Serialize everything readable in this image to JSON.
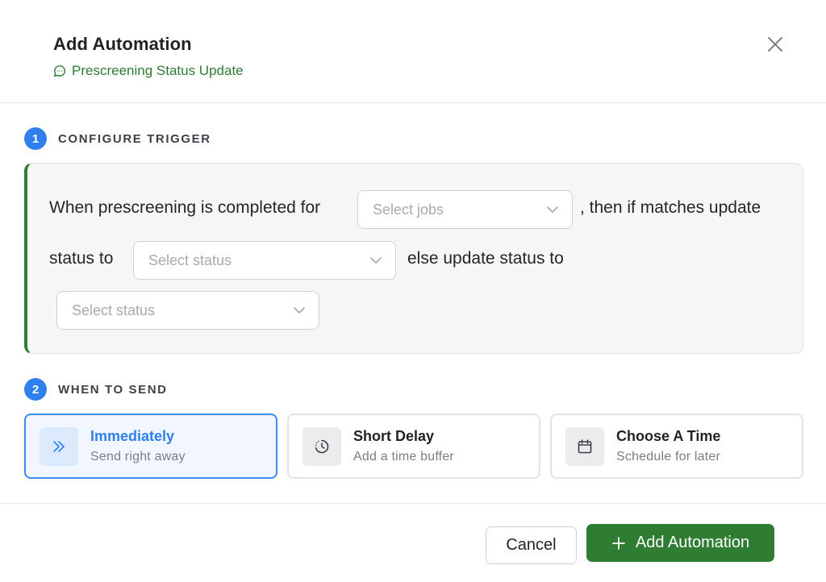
{
  "header": {
    "title": "Add Automation",
    "subtitle": "Prescreening Status Update",
    "subtitle_icon": "chat-bubble-icon",
    "close_icon": "close-icon"
  },
  "steps": [
    {
      "number": "1",
      "label": "CONFIGURE TRIGGER"
    },
    {
      "number": "2",
      "label": "WHEN TO SEND"
    }
  ],
  "trigger": {
    "text_1": "When prescreening is completed for",
    "jobs_placeholder": "Select jobs",
    "text_2": ", then if matches update",
    "text_3": "status to",
    "status_placeholder_1": "Select status",
    "text_4": "else update status to",
    "status_placeholder_2": "Select status"
  },
  "send_options": [
    {
      "title": "Immediately",
      "description": "Send right away",
      "icon": "double-chevron-right-icon",
      "selected": true
    },
    {
      "title": "Short Delay",
      "description": "Add a time buffer",
      "icon": "clock-icon",
      "selected": false
    },
    {
      "title": "Choose A Time",
      "description": "Schedule for later",
      "icon": "calendar-icon",
      "selected": false
    }
  ],
  "footer": {
    "cancel_label": "Cancel",
    "add_label": "Add Automation"
  },
  "colors": {
    "accent_green": "#2e7d32",
    "accent_blue": "#2f80ed"
  }
}
